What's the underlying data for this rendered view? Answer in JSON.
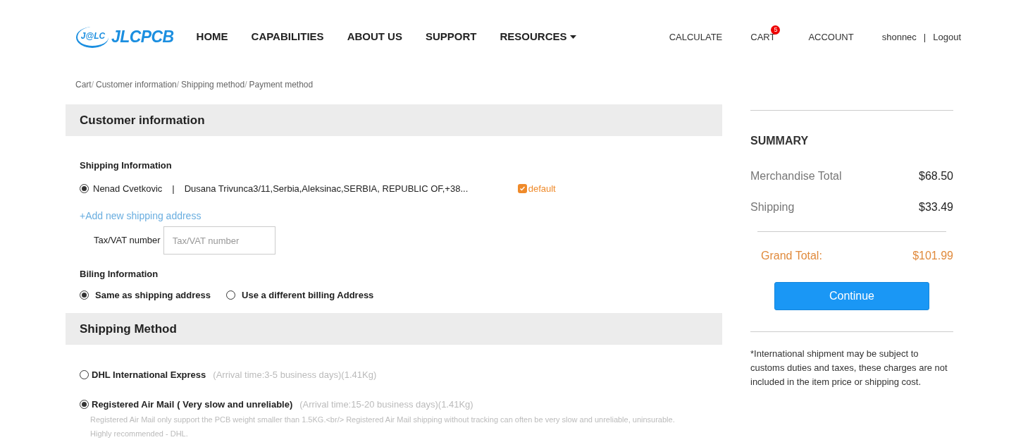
{
  "header": {
    "logo_mark": "J@LC",
    "logo_text": "JLCPCB",
    "nav": [
      {
        "label": "HOME",
        "dropdown": false
      },
      {
        "label": "CAPABILITIES",
        "dropdown": false
      },
      {
        "label": "ABOUT US",
        "dropdown": false
      },
      {
        "label": "SUPPORT",
        "dropdown": false
      },
      {
        "label": "RESOURCES",
        "dropdown": true
      }
    ],
    "links": [
      {
        "label": "CALCULATE"
      },
      {
        "label": "CART",
        "badge": "5"
      },
      {
        "label": "ACCOUNT"
      }
    ],
    "user": "shonnec",
    "separator": "|",
    "logout": "Logout"
  },
  "breadcrumb": {
    "separator": "/",
    "items": [
      "Cart",
      "Customer information",
      "Shipping method",
      "Payment method"
    ]
  },
  "customer": {
    "title": "Customer information",
    "shipping_heading": "Shipping Information",
    "addresses": [
      {
        "name": "Nenad Cvetkovic",
        "separator": "|",
        "address": "Dusana Trivunca3/11,Serbia,Aleksinac,SERBIA, REPUBLIC OF,+38...",
        "selected": true,
        "default_checked": true,
        "default_label": "default"
      }
    ],
    "add_link": "+Add new shipping address",
    "tax": {
      "label": "Tax/VAT number",
      "placeholder": "Tax/VAT number"
    },
    "billing_heading": "Biling Information",
    "billing_options": [
      {
        "label": "Same as shipping address",
        "selected": true
      },
      {
        "label": "Use a different billing Address",
        "selected": false
      }
    ]
  },
  "shipping_method": {
    "title": "Shipping Method",
    "options": [
      {
        "name": "DHL International Express",
        "arrival": "(Arrival time:3-5 business days)(1.41Kg)",
        "selected": false
      },
      {
        "name": "Registered Air Mail",
        "note": "( Very slow and unreliable)",
        "arrival": "(Arrival time:15-20 business days)(1.41Kg)",
        "selected": true,
        "description": "Registered Air Mail only support the PCB weight smaller than 1.5KG.<br/> Registered Air Mail shipping without tracking can often be very slow and unreliable, uninsurable. Highly recommended - DHL."
      }
    ]
  },
  "summary": {
    "title": "SUMMARY",
    "rows": [
      {
        "label": "Merchandise Total",
        "value": "$68.50"
      },
      {
        "label": "Shipping",
        "value": "$33.49"
      }
    ],
    "grand_total": {
      "label": "Grand Total:",
      "value": "$101.99"
    },
    "button": "Continue",
    "notice": "*International shipment may be subject to customs duties and taxes, these charges are not included in the item price or shipping cost."
  }
}
